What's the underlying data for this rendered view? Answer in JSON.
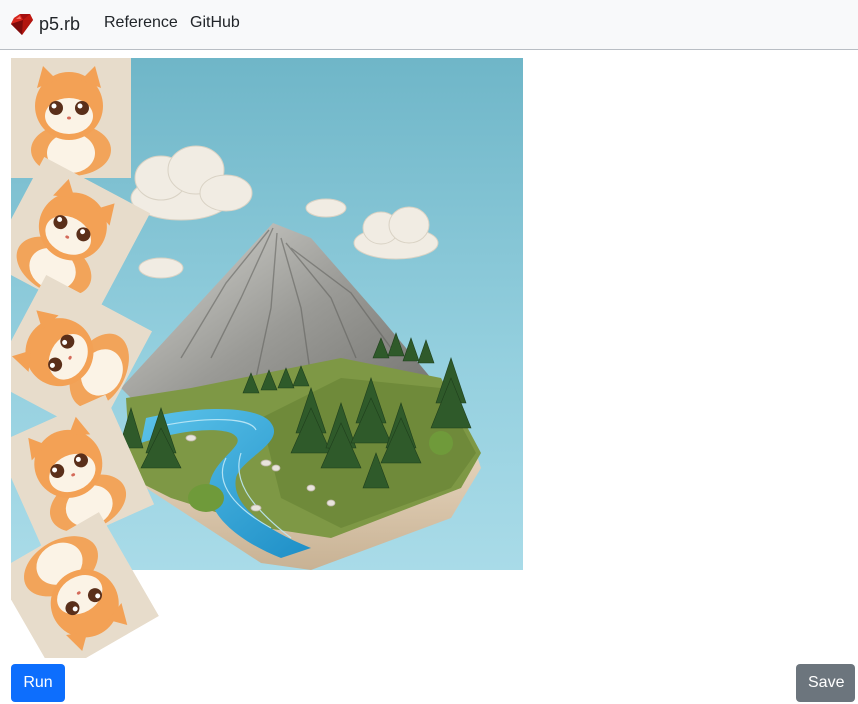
{
  "navbar": {
    "brand": "p5.rb",
    "brand_icon": "ruby-gem-icon",
    "links": [
      {
        "label": "Reference"
      },
      {
        "label": "GitHub"
      }
    ]
  },
  "canvas": {
    "background_image": "clay-mountain-river-diorama",
    "stamp_image": "cute-orange-cat-sticker",
    "stamp_count": 5
  },
  "buttons": {
    "run_label": "Run",
    "save_label": "Save"
  },
  "colors": {
    "primary": "#0d6efd",
    "secondary": "#6c757d",
    "navbar_bg": "#f8f9fa"
  }
}
